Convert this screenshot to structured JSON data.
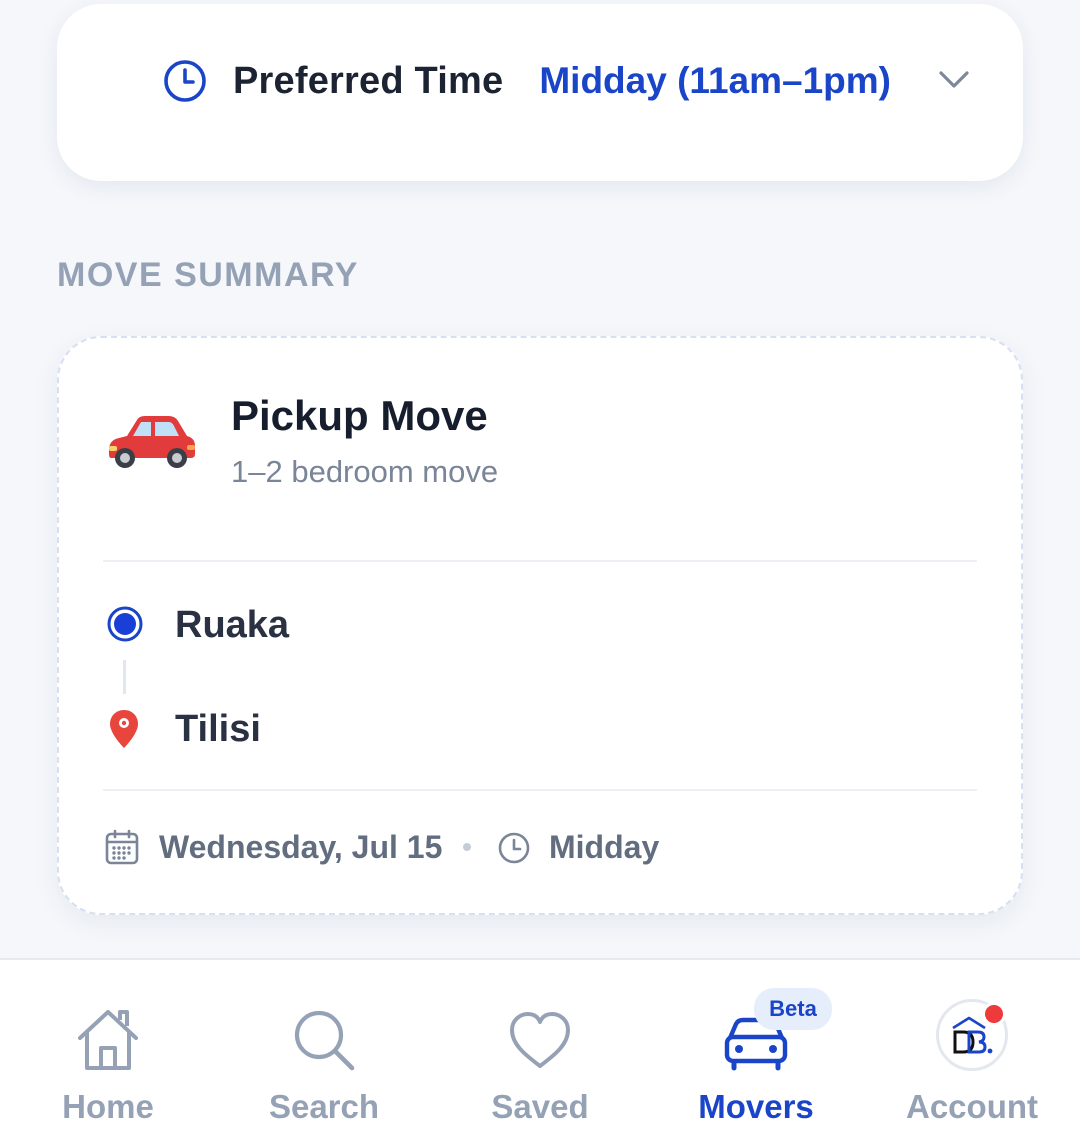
{
  "preferred_time": {
    "label": "Preferred Time",
    "value": "Midday (11am–1pm)"
  },
  "move_summary": {
    "section_title": "MOVE SUMMARY",
    "move_type": "Pickup Move",
    "move_size": "1–2 bedroom move",
    "origin": "Ruaka",
    "destination": "Tilisi",
    "date": "Wednesday, Jul 15",
    "time": "Midday"
  },
  "nav": {
    "items": [
      {
        "label": "Home",
        "icon": "home-icon"
      },
      {
        "label": "Search",
        "icon": "search-icon"
      },
      {
        "label": "Saved",
        "icon": "heart-icon"
      },
      {
        "label": "Movers",
        "icon": "car-icon",
        "active": true
      },
      {
        "label": "Account",
        "icon": "avatar"
      }
    ],
    "beta_badge": "Beta"
  },
  "colors": {
    "accent": "#1a45c8",
    "muted": "#95a1b5",
    "background": "#f5f7fb",
    "pin_red": "#e8453c"
  }
}
